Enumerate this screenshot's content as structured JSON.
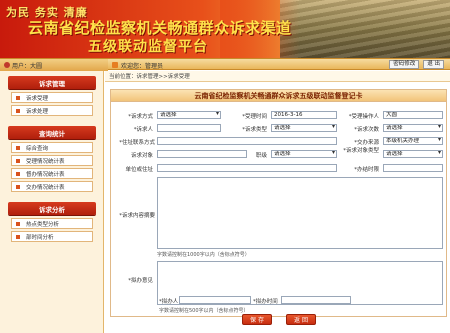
{
  "banner": {
    "slogan": "为民  务实  清廉",
    "title_line1": "云南省纪检监察机关畅通群众诉求渠道",
    "title_line2": "五级联动监督平台"
  },
  "topbar": {
    "user_label": "用户：大圆",
    "welcome": "欢迎您：管理员",
    "change_password": "密码修改",
    "logout": "退  出"
  },
  "sidebar": {
    "sections": [
      {
        "title": "诉求管理",
        "items": [
          "诉求受理",
          "诉求处理"
        ]
      },
      {
        "title": "查询统计",
        "items": [
          "综合查询",
          "受理情况统计表",
          "督办情况统计表",
          "交办情况统计表"
        ]
      },
      {
        "title": "诉求分析",
        "items": [
          "热点类型分析",
          "部时间分析"
        ]
      }
    ]
  },
  "breadcrumb": "当前位置：诉求管理>>诉求受理",
  "form": {
    "title": "云南省纪检监察机关畅通群众诉求五级联动监督登记卡",
    "fields": {
      "appeal_method_label": "*诉求方式",
      "appeal_method_value": "请选择",
      "receive_time_label": "*受理时间",
      "receive_time_value": "2016-3-16",
      "receiver_label": "*受理操作人",
      "receiver_value": "大圆",
      "petitioner_label": "*诉求人",
      "petitioner_value": "",
      "appeal_type_label": "*诉求类型",
      "appeal_type_value": "请选择",
      "appeal_count_label": "*诉求次数",
      "appeal_count_value": "请选择",
      "address_label": "*住址联系方式",
      "address_value": "",
      "source_label": "*交办来源",
      "source_value": "本级机关办理",
      "appeal_target_label": "诉求对象",
      "appeal_target_value": "",
      "position_label": "职级",
      "position_value": "请选择",
      "target_type_label": "*诉求对象类型",
      "target_type_value": "请选择",
      "workplace_label": "单位或住址",
      "workplace_value": "",
      "deadline_label": "*办结时限",
      "deadline_value": "",
      "content_label": "*诉求内容摘要",
      "content_note": "字数请控制在1000字以内（含标点符号）",
      "opinion_label": "*拟办意见",
      "opinion_person_label": "*拟办人",
      "opinion_person_value": "",
      "opinion_time_label": "*拟办时间",
      "opinion_time_value": "",
      "opinion_note": "字数请控制在500字以内（含标点符号）"
    }
  },
  "buttons": {
    "save": "保 存",
    "back": "返 回"
  }
}
